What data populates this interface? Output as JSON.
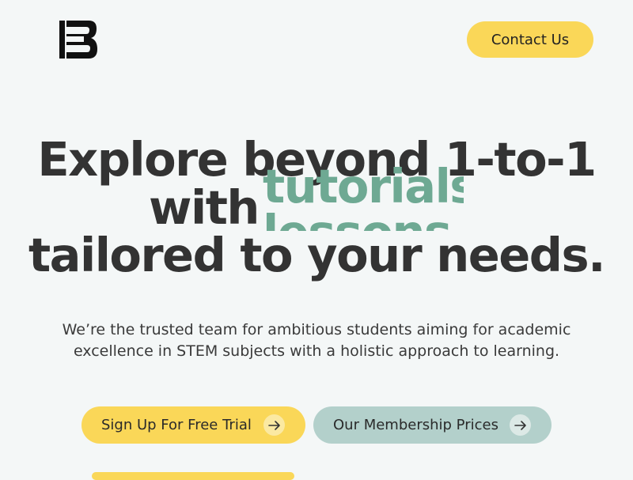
{
  "header": {
    "logo_icon": "bb-logo-icon",
    "contact_label": "Contact Us"
  },
  "hero": {
    "line1": "Explore beyond 1-to-1",
    "line2_prefix": "with",
    "rotating_words": [
      "tutorials",
      "lessons"
    ],
    "line3": "tailored to your needs."
  },
  "subtext": {
    "line1": "We’re the trusted team for ambitious students aiming for academic",
    "line2": "excellence in STEM subjects with a holistic approach to learning."
  },
  "cta": {
    "trial_label": "Sign Up For Free Trial",
    "prices_label": "Our Membership Prices",
    "arrow_icon": "arrow-right-icon"
  },
  "colors": {
    "background": "#f4f7f7",
    "accent_yellow": "#fad758",
    "accent_green": "#6ea993",
    "secondary_button": "#b3d0cb",
    "text": "#333333"
  }
}
